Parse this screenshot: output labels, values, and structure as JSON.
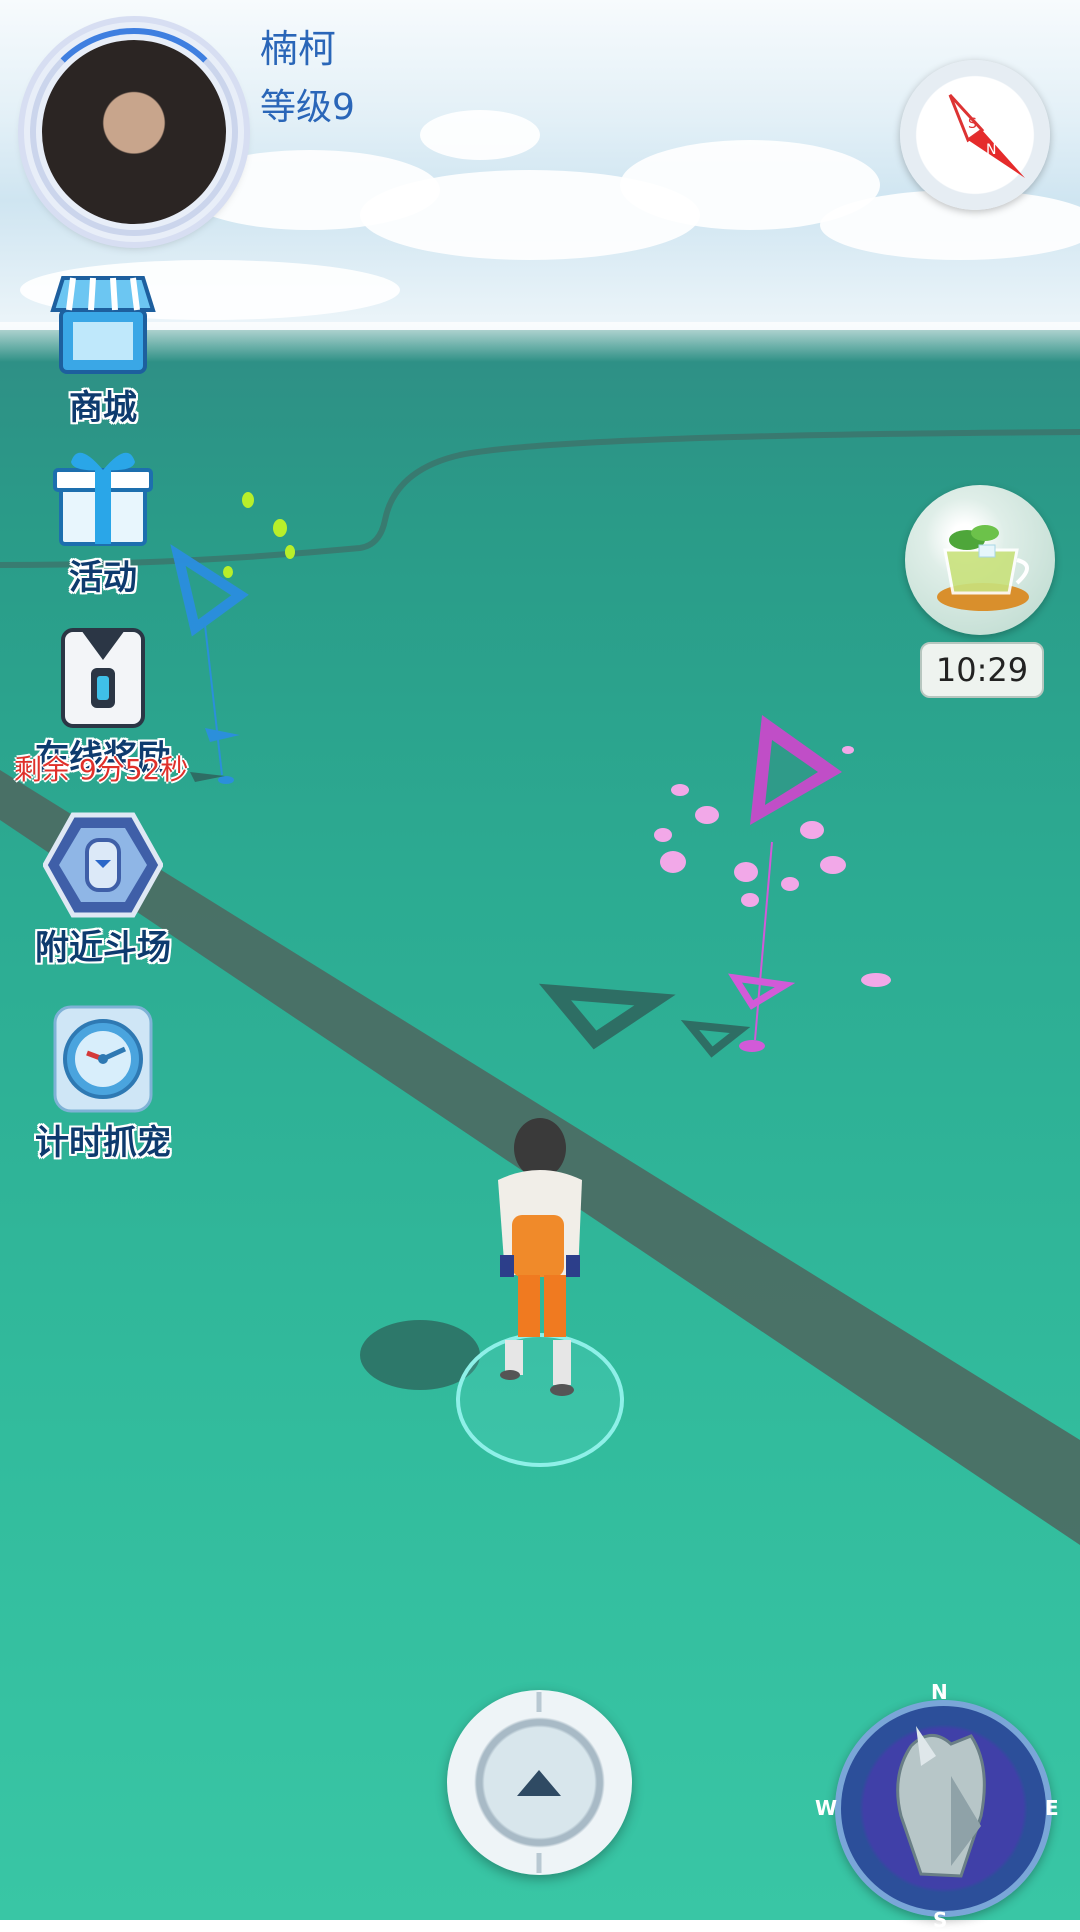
{
  "player": {
    "name": "楠柯",
    "level": "等级9"
  },
  "menu": {
    "shop": "商城",
    "events": "活动",
    "online_reward": "在线奖励",
    "online_reward_countdown": "剩余 9分52秒",
    "nearby_arena": "附近斗场",
    "timed_catch": "计时抓宠"
  },
  "buff": {
    "timer": "10:29"
  },
  "radar": {
    "north": "N",
    "south": "S",
    "east": "E",
    "west": "W"
  },
  "compass": {
    "south": "S",
    "north": "N"
  },
  "colors": {
    "ground": "#2cab92",
    "road": "#4a6f66",
    "gym_pink": "#d25ad8",
    "pokestop_blue": "#2b8ee0",
    "level_text": "#2a66b8",
    "countdown_text": "#e0302a"
  },
  "icons": {
    "shop": "shop-icon",
    "events": "gift-icon",
    "online_reward": "reward-box-icon",
    "nearby_arena": "arena-icon",
    "timed_catch": "stopwatch-icon",
    "buff": "tea-cup-icon",
    "main": "ball-icon",
    "radar": "radar-icon",
    "compass": "compass-icon"
  }
}
